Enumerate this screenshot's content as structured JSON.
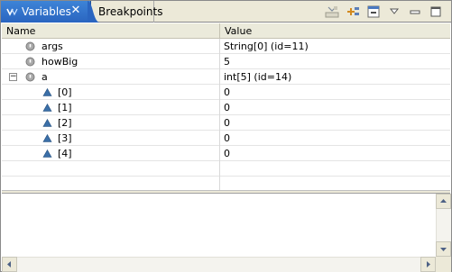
{
  "tabs": {
    "variables_label": "Variables",
    "breakpoints_label": "Breakpoints"
  },
  "toolbar": {
    "icons": [
      "show-type-names-icon",
      "select-all-icon",
      "collapse-all-icon",
      "view-menu-icon",
      "minimize-icon",
      "maximize-icon"
    ]
  },
  "table": {
    "columns": {
      "name": "Name",
      "value": "Value"
    },
    "rows": [
      {
        "name": "args",
        "value": "String[0]  (id=11)",
        "icon": "local-variable-icon",
        "expanded": null
      },
      {
        "name": "howBig",
        "value": "5",
        "icon": "local-variable-icon",
        "expanded": null
      },
      {
        "name": "a",
        "value": "int[5]  (id=14)",
        "icon": "local-variable-icon",
        "expanded": true
      },
      {
        "name": "[0]",
        "value": "0",
        "icon": "array-element-icon",
        "expanded": null
      },
      {
        "name": "[1]",
        "value": "0",
        "icon": "array-element-icon",
        "expanded": null
      },
      {
        "name": "[2]",
        "value": "0",
        "icon": "array-element-icon",
        "expanded": null
      },
      {
        "name": "[3]",
        "value": "0",
        "icon": "array-element-icon",
        "expanded": null
      },
      {
        "name": "[4]",
        "value": "0",
        "icon": "array-element-icon",
        "expanded": null
      }
    ],
    "expander_glyph": "−"
  },
  "colors": {
    "active_tab": "#2a65c0",
    "header_bg": "#ebeadb",
    "chrome_bg": "#ece9d8",
    "local_var_icon": "#9a9a9a",
    "array_elem_icon": "#3b6fa8"
  }
}
